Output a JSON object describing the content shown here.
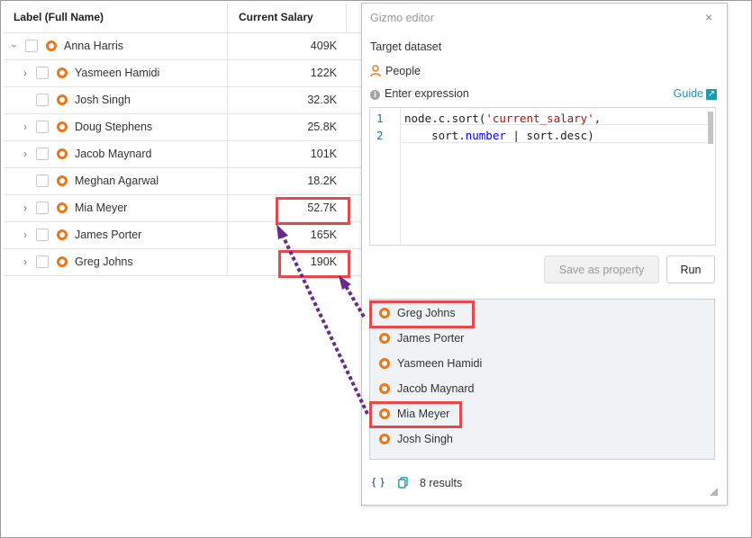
{
  "table": {
    "col_label": "Label (Full Name)",
    "col_salary": "Current Salary",
    "rows": [
      {
        "name": "Anna Harris",
        "salary": "409K"
      },
      {
        "name": "Yasmeen Hamidi",
        "salary": "122K"
      },
      {
        "name": "Josh Singh",
        "salary": "32.3K"
      },
      {
        "name": "Doug Stephens",
        "salary": "25.8K"
      },
      {
        "name": "Jacob Maynard",
        "salary": "101K"
      },
      {
        "name": "Meghan Agarwal",
        "salary": "18.2K"
      },
      {
        "name": "Mia Meyer",
        "salary": "52.7K"
      },
      {
        "name": "James Porter",
        "salary": "165K"
      },
      {
        "name": "Greg Johns",
        "salary": "190K"
      }
    ]
  },
  "editor": {
    "title": "Gizmo editor",
    "close": "×",
    "target_label": "Target dataset",
    "dataset": "People",
    "expression_label": "Enter expression",
    "guide": "Guide",
    "code": {
      "line1_num": "1",
      "line2_num": "2",
      "l1_a": "node.c.sort(",
      "l1_str": "'current_salary'",
      "l1_b": ",",
      "l2_indent": "    sort.",
      "l2_kw": "number",
      "l2_b": " | sort.desc)"
    },
    "save_button": "Save as property",
    "run_button": "Run",
    "results": [
      "Greg Johns",
      "James Porter",
      "Yasmeen Hamidi",
      "Jacob Maynard",
      "Mia Meyer",
      "Josh Singh"
    ],
    "footer_code_icon": "{ }",
    "result_count": "8 results"
  },
  "colors": {
    "accent": "#1a9bb0",
    "node": "#e8781c",
    "highlight": "#e5484d",
    "arrow": "#6a2a8a"
  }
}
